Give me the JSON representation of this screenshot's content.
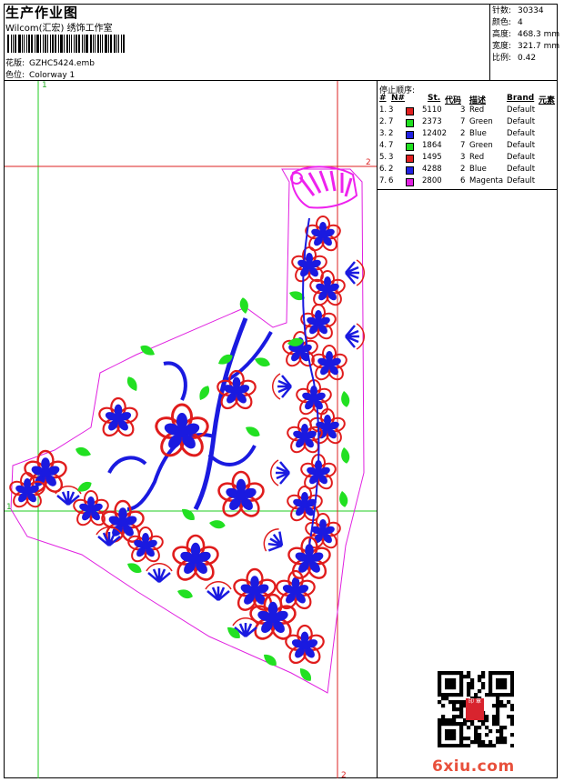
{
  "header": {
    "title": "生产作业图",
    "studio": "Wilcom(汇宏) 绣饰工作室",
    "design_label": "花版:",
    "design_file": "GZHC5424.emb",
    "colorway_label": "色位:",
    "colorway": "Colorway 1"
  },
  "stats": [
    {
      "label": "针数:",
      "value": "30334"
    },
    {
      "label": "颜色:",
      "value": "4"
    },
    {
      "label": "高度:",
      "value": "468.3 mm"
    },
    {
      "label": "宽度:",
      "value": "321.7 mm"
    },
    {
      "label": "比例:",
      "value": "0.42"
    }
  ],
  "sequence": {
    "title": "停止顺序:",
    "columns": [
      "#",
      "N#",
      "St.",
      "代码",
      "描述",
      "Brand",
      "元素"
    ],
    "rows": [
      {
        "num": "1.",
        "needle": "3",
        "color": "#e02020",
        "stitches": "5110",
        "code": "3",
        "desc": "Red",
        "brand": "Default"
      },
      {
        "num": "2.",
        "needle": "7",
        "color": "#20e020",
        "stitches": "2373",
        "code": "7",
        "desc": "Green",
        "brand": "Default"
      },
      {
        "num": "3.",
        "needle": "2",
        "color": "#2020e0",
        "stitches": "12402",
        "code": "2",
        "desc": "Blue",
        "brand": "Default"
      },
      {
        "num": "4.",
        "needle": "7",
        "color": "#20e020",
        "stitches": "1864",
        "code": "7",
        "desc": "Green",
        "brand": "Default"
      },
      {
        "num": "5.",
        "needle": "3",
        "color": "#e02020",
        "stitches": "1495",
        "code": "3",
        "desc": "Red",
        "brand": "Default"
      },
      {
        "num": "6.",
        "needle": "2",
        "color": "#2020e0",
        "stitches": "4288",
        "code": "2",
        "desc": "Blue",
        "brand": "Default"
      },
      {
        "num": "7.",
        "needle": "6",
        "color": "#e020e0",
        "stitches": "2800",
        "code": "6",
        "desc": "Magenta",
        "brand": "Default"
      }
    ]
  },
  "guides": {
    "green_v_top": "1",
    "green_h_left": "1",
    "red_h_right": "2",
    "red_v_bottom": "2"
  },
  "watermark": {
    "site": "6xiu.com",
    "stamp": "印 章"
  },
  "colors": {
    "guide_green": "#22cc22",
    "guide_red": "#dd2222",
    "outline": "#e020e0",
    "thread_blue": "#1a1ae0",
    "thread_red": "#e01c1c",
    "thread_green": "#22e022",
    "thread_magenta": "#ee22ee"
  }
}
